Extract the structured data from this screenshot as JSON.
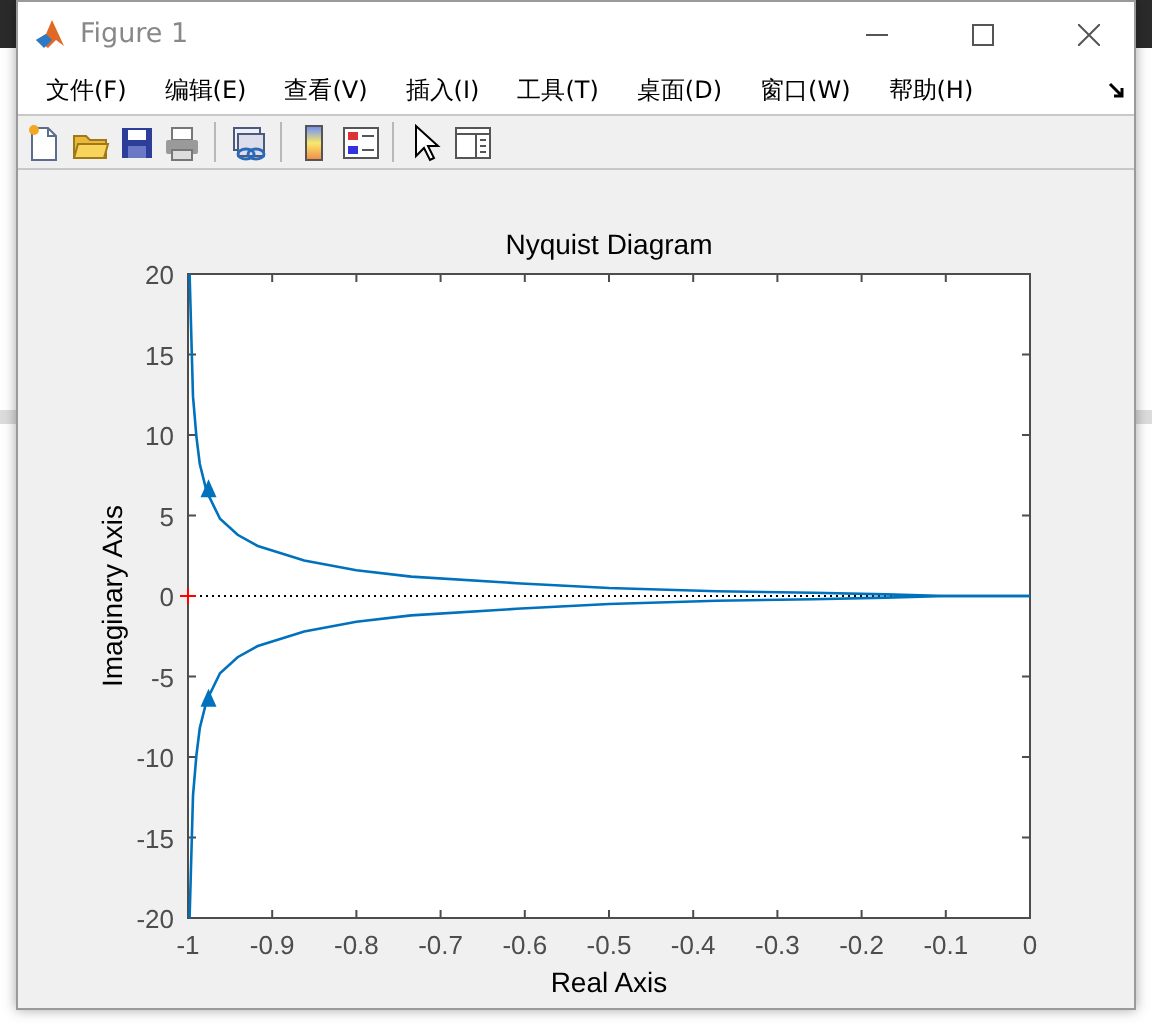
{
  "window": {
    "title": "Figure 1"
  },
  "menu": [
    "文件(F)",
    "编辑(E)",
    "查看(V)",
    "插入(I)",
    "工具(T)",
    "桌面(D)",
    "窗口(W)",
    "帮助(H)"
  ],
  "plot": {
    "chart_data": {
      "type": "line",
      "title": "Nyquist Diagram",
      "xlabel": "Real Axis",
      "ylabel": "Imaginary Axis",
      "x": [
        -0.998,
        -0.994,
        -0.99,
        -0.986,
        -0.978,
        -0.962,
        -0.941,
        -0.917,
        -0.862,
        -0.8,
        -0.735,
        -0.61,
        -0.5,
        -0.372,
        -0.257,
        -0.171,
        -0.1,
        -0.038,
        -0.01,
        0
      ],
      "series": [
        {
          "color": "#0072bd",
          "values": [
            -20,
            -12.4,
            -9.9,
            -8.2,
            -6.5,
            -4.8,
            -3.8,
            -3.1,
            -2.2,
            -1.6,
            -1.2,
            -0.8,
            -0.5,
            -0.3,
            -0.2,
            -0.1,
            0,
            0,
            0,
            0
          ]
        },
        {
          "color": "#0072bd",
          "values": [
            20,
            12.4,
            9.9,
            8.2,
            6.5,
            4.8,
            3.8,
            3.1,
            2.2,
            1.6,
            1.2,
            0.8,
            0.5,
            0.3,
            0.2,
            0.1,
            0,
            0,
            0,
            0
          ]
        }
      ],
      "xlim": [
        -1,
        0
      ],
      "ylim": [
        -20,
        20
      ],
      "xticks": [
        -1,
        -0.9,
        -0.8,
        -0.7,
        -0.6,
        -0.5,
        -0.4,
        -0.3,
        -0.2,
        -0.1,
        0
      ],
      "yticks": [
        -20,
        -15,
        -10,
        -5,
        0,
        5,
        10,
        15,
        20
      ]
    }
  }
}
